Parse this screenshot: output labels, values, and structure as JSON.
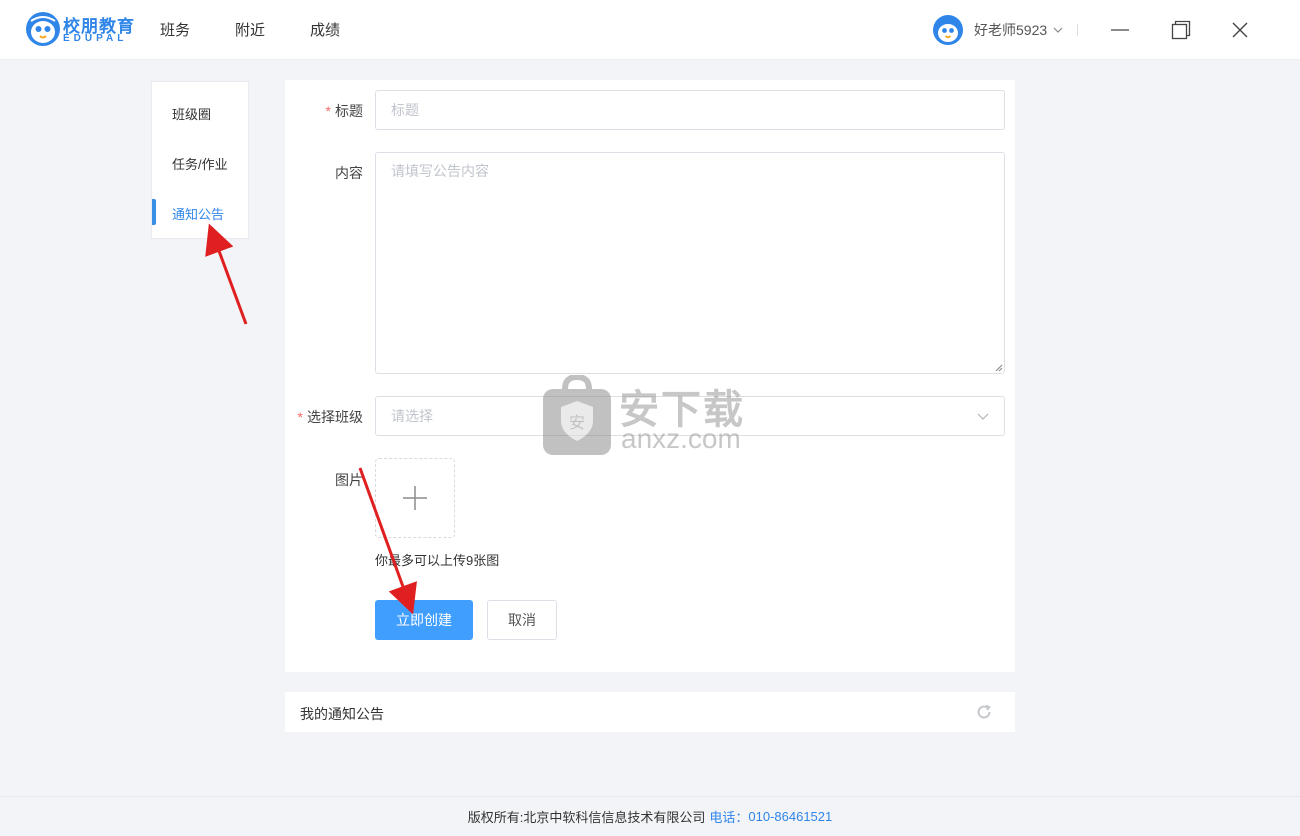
{
  "app": {
    "logo_cn": "校朋教育",
    "logo_en": "EDUPAL",
    "brand_color": "#2f86e8"
  },
  "nav": {
    "items": [
      {
        "label": "班务"
      },
      {
        "label": "附近"
      },
      {
        "label": "成绩"
      }
    ]
  },
  "user": {
    "name": "好老师5923",
    "avatar_icon": "mascot-avatar-icon"
  },
  "window_controls": [
    "minimize-icon",
    "maximize-icon",
    "close-icon"
  ],
  "sidebar": {
    "items": [
      {
        "label": "班级圈",
        "active": false
      },
      {
        "label": "任务/作业",
        "active": false
      },
      {
        "label": "通知公告",
        "active": true
      }
    ]
  },
  "form": {
    "title": {
      "label": "标题",
      "required": "*",
      "placeholder": "标题",
      "value": ""
    },
    "content": {
      "label": "内容",
      "placeholder": "请填写公告内容",
      "value": ""
    },
    "class_select": {
      "label": "选择班级",
      "required": "*",
      "placeholder": "请选择"
    },
    "image": {
      "label": "图片",
      "tip": "你最多可以上传9张图"
    },
    "submit_label": "立即创建",
    "cancel_label": "取消"
  },
  "my_notices": {
    "title": "我的通知公告"
  },
  "footer": {
    "copyright": "版权所有:北京中软科信信息技术有限公司",
    "phone_label": "电话：",
    "phone": "010-86461521"
  },
  "watermark": {
    "cn": "安下载",
    "en": "anxz.com"
  },
  "colors": {
    "primary": "#409eff",
    "required": "#f56c6c",
    "arrow": "#e02020"
  }
}
